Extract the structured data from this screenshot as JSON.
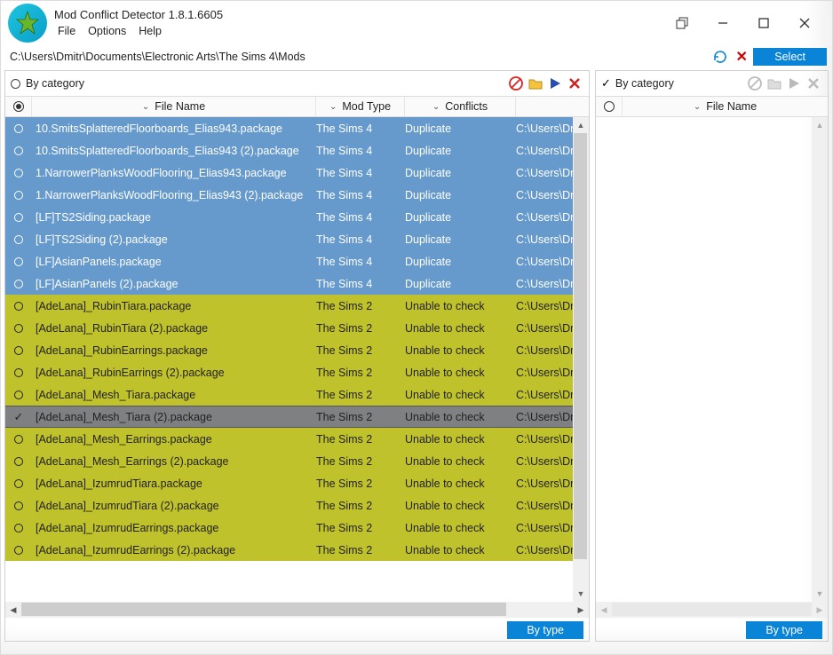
{
  "app_title": "Mod Conflict Detector 1.8.1.6605",
  "menu": {
    "file": "File",
    "options": "Options",
    "help": "Help"
  },
  "path": "C:\\Users\\Dmitr\\Documents\\Electronic Arts\\The Sims 4\\Mods",
  "select_btn": "Select",
  "by_category_left": "By category",
  "by_category_right": "By category",
  "headers": {
    "file_name": "File Name",
    "mod_type": "Mod Type",
    "conflicts": "Conflicts"
  },
  "by_type_btn": "By type",
  "mod_types": {
    "sims4": "The Sims 4",
    "sims2": "The Sims 2"
  },
  "conflict_types": {
    "dup": "Duplicate",
    "unable": "Unable to check"
  },
  "path_trunc": "C:\\Users\\Dmit",
  "rows": [
    {
      "file": "10.SmitsSplatteredFloorboards_Elias943.package",
      "mod": "sims4",
      "conf": "dup",
      "kind": "blue"
    },
    {
      "file": "10.SmitsSplatteredFloorboards_Elias943 (2).package",
      "mod": "sims4",
      "conf": "dup",
      "kind": "blue"
    },
    {
      "file": "1.NarrowerPlanksWoodFlooring_Elias943.package",
      "mod": "sims4",
      "conf": "dup",
      "kind": "blue"
    },
    {
      "file": "1.NarrowerPlanksWoodFlooring_Elias943 (2).package",
      "mod": "sims4",
      "conf": "dup",
      "kind": "blue"
    },
    {
      "file": "[LF]TS2Siding.package",
      "mod": "sims4",
      "conf": "dup",
      "kind": "blue"
    },
    {
      "file": "[LF]TS2Siding (2).package",
      "mod": "sims4",
      "conf": "dup",
      "kind": "blue"
    },
    {
      "file": "[LF]AsianPanels.package",
      "mod": "sims4",
      "conf": "dup",
      "kind": "blue"
    },
    {
      "file": "[LF]AsianPanels (2).package",
      "mod": "sims4",
      "conf": "dup",
      "kind": "blue"
    },
    {
      "file": "[AdeLana]_RubinTiara.package",
      "mod": "sims2",
      "conf": "unable",
      "kind": "olive"
    },
    {
      "file": "[AdeLana]_RubinTiara (2).package",
      "mod": "sims2",
      "conf": "unable",
      "kind": "olive"
    },
    {
      "file": "[AdeLana]_RubinEarrings.package",
      "mod": "sims2",
      "conf": "unable",
      "kind": "olive"
    },
    {
      "file": "[AdeLana]_RubinEarrings (2).package",
      "mod": "sims2",
      "conf": "unable",
      "kind": "olive"
    },
    {
      "file": "[AdeLana]_Mesh_Tiara.package",
      "mod": "sims2",
      "conf": "unable",
      "kind": "olive"
    },
    {
      "file": "[AdeLana]_Mesh_Tiara (2).package",
      "mod": "sims2",
      "conf": "unable",
      "kind": "olive",
      "selected": true
    },
    {
      "file": "[AdeLana]_Mesh_Earrings.package",
      "mod": "sims2",
      "conf": "unable",
      "kind": "olive"
    },
    {
      "file": "[AdeLana]_Mesh_Earrings (2).package",
      "mod": "sims2",
      "conf": "unable",
      "kind": "olive"
    },
    {
      "file": "[AdeLana]_IzumrudTiara.package",
      "mod": "sims2",
      "conf": "unable",
      "kind": "olive"
    },
    {
      "file": "[AdeLana]_IzumrudTiara (2).package",
      "mod": "sims2",
      "conf": "unable",
      "kind": "olive"
    },
    {
      "file": "[AdeLana]_IzumrudEarrings.package",
      "mod": "sims2",
      "conf": "unable",
      "kind": "olive"
    },
    {
      "file": "[AdeLana]_IzumrudEarrings (2).package",
      "mod": "sims2",
      "conf": "unable",
      "kind": "olive"
    }
  ]
}
